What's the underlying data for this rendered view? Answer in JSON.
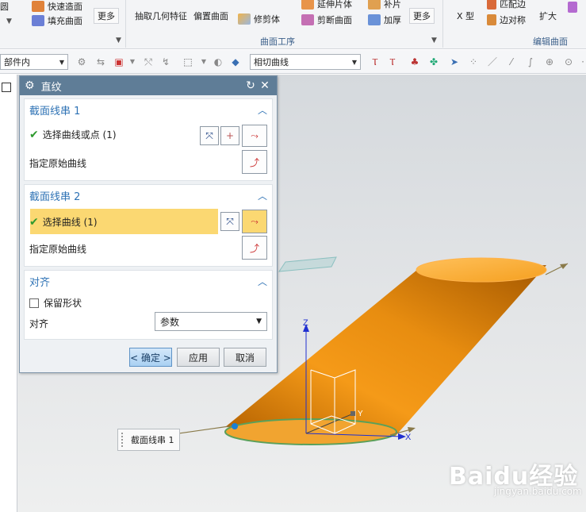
{
  "ribbon": {
    "items_left": [
      {
        "label": "快速造面",
        "icon": "quick-surface-icon",
        "color": "#e0823a"
      },
      {
        "label": "填充曲面",
        "icon": "fill-surface-icon",
        "color": "#6b7fd6"
      }
    ],
    "more1": "更多",
    "items_mid": [
      {
        "label": "抽取几何特征",
        "icon": "extract-geometry-icon"
      },
      {
        "label": "偏置曲面",
        "icon": "offset-surface-icon"
      },
      {
        "label": "修剪体",
        "icon": "trim-body-icon"
      },
      {
        "label": "延伸片体",
        "icon": "extend-sheet-icon"
      },
      {
        "label": "剪断曲面",
        "icon": "divide-face-icon"
      },
      {
        "label": "补片",
        "icon": "patch-icon"
      },
      {
        "label": "加厚",
        "icon": "thicken-icon"
      }
    ],
    "more2": "更多",
    "group_surface_ops": "曲面工序",
    "items_right": [
      {
        "label": "X 型",
        "icon": "x-form-icon"
      },
      {
        "label": "匹配边",
        "icon": "match-edge-icon"
      },
      {
        "label": "边对称",
        "icon": "edge-symmetry-icon"
      },
      {
        "label": "扩大",
        "icon": "enlarge-icon"
      }
    ],
    "group_edit_surface": "编辑曲面"
  },
  "toolbar": {
    "filter_select": "部件内",
    "curve_rule_select": "相切曲线"
  },
  "dialog": {
    "title": "直纹",
    "section1": {
      "title": "截面线串 1",
      "select_label": "选择曲线或点 (1)",
      "origin_label": "指定原始曲线"
    },
    "section2": {
      "title": "截面线串 2",
      "select_label": "选择曲线 (1)",
      "origin_label": "指定原始曲线"
    },
    "align": {
      "title": "对齐",
      "keep_shape": "保留形状",
      "align_label": "对齐",
      "align_value": "参数"
    },
    "buttons": {
      "ok": "< 确定 >",
      "apply": "应用",
      "cancel": "取消"
    }
  },
  "viewport": {
    "axis_z": "Z",
    "axis_x": "X",
    "axis_y": "Y",
    "section_tag": "截面线串 1",
    "surface_color": "#f5a623",
    "surface_dark": "#c76b00"
  },
  "watermark": {
    "brand": "Baidu经验",
    "url": "jingyan.baidu.com"
  }
}
